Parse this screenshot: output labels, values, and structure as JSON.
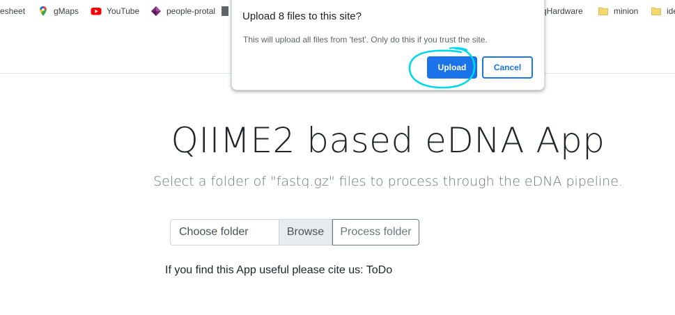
{
  "bookmarks": [
    {
      "label": "esheet",
      "icon": "none"
    },
    {
      "label": "gMaps",
      "icon": "google-maps-icon"
    },
    {
      "label": "YouTube",
      "icon": "youtube-icon"
    },
    {
      "label": "people-protal",
      "icon": "power-apps-icon"
    },
    {
      "label": "qHardware",
      "icon": "none"
    },
    {
      "label": "minion",
      "icon": "folder-icon"
    },
    {
      "label": "ide",
      "icon": "folder-icon"
    }
  ],
  "main": {
    "title": "QIIME2 based eDNA App",
    "lead": "Select a folder of \"fastq.gz\" files to process through the eDNA pipeline.",
    "folder_label": "Choose folder",
    "browse_label": "Browse",
    "process_label": "Process folder",
    "cite_text": "If you find this App useful please cite us: ToDo"
  },
  "dialog": {
    "title": "Upload 8 files to this site?",
    "message": "This will upload all files from 'test'. Only do this if you trust the site.",
    "upload_label": "Upload",
    "cancel_label": "Cancel"
  },
  "colors": {
    "accent": "#1a73e8",
    "highlight": "#00d8e8",
    "youtube": "#ff0000",
    "folder": "#f5d76e"
  }
}
